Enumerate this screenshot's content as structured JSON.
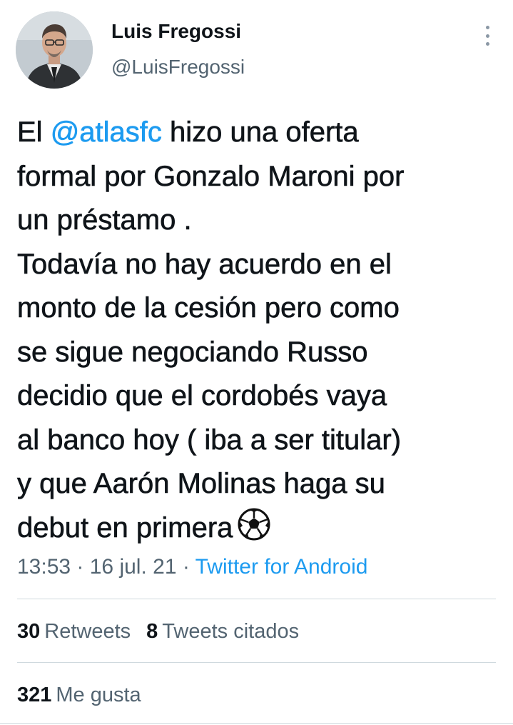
{
  "author": {
    "display_name": "Luis Fregossi",
    "handle": "@LuisFregossi",
    "avatar_icon": "profile-photo"
  },
  "tweet": {
    "line1_before": "El ",
    "line1_mention": "@atlasfc",
    "line1_after": " hizo una oferta",
    "line2": "formal por Gonzalo Maroni por",
    "line3": "un préstamo .",
    "line4": "Todavía no hay acuerdo en el",
    "line5": "monto de la cesión pero como",
    "line6": "se sigue negociando Russo",
    "line7": "decidio que el cordobés vaya",
    "line8": "al banco hoy ( iba a ser titular)",
    "line9": "y que Aarón Molinas haga su",
    "line10": "debut en primera",
    "emoji": "soccer-ball-icon"
  },
  "meta": {
    "time": "13:53",
    "separator1": " · ",
    "date": "16 jul. 21",
    "separator2": " · ",
    "source": "Twitter for Android"
  },
  "stats": {
    "retweets_count": "30",
    "retweets_label": "Retweets",
    "quotes_count": "8",
    "quotes_label": "Tweets citados",
    "likes_count": "321",
    "likes_label": "Me gusta"
  },
  "colors": {
    "link": "#1d9bf0",
    "text": "#0f1419",
    "secondary": "#536471",
    "divider": "#cfd9de"
  }
}
